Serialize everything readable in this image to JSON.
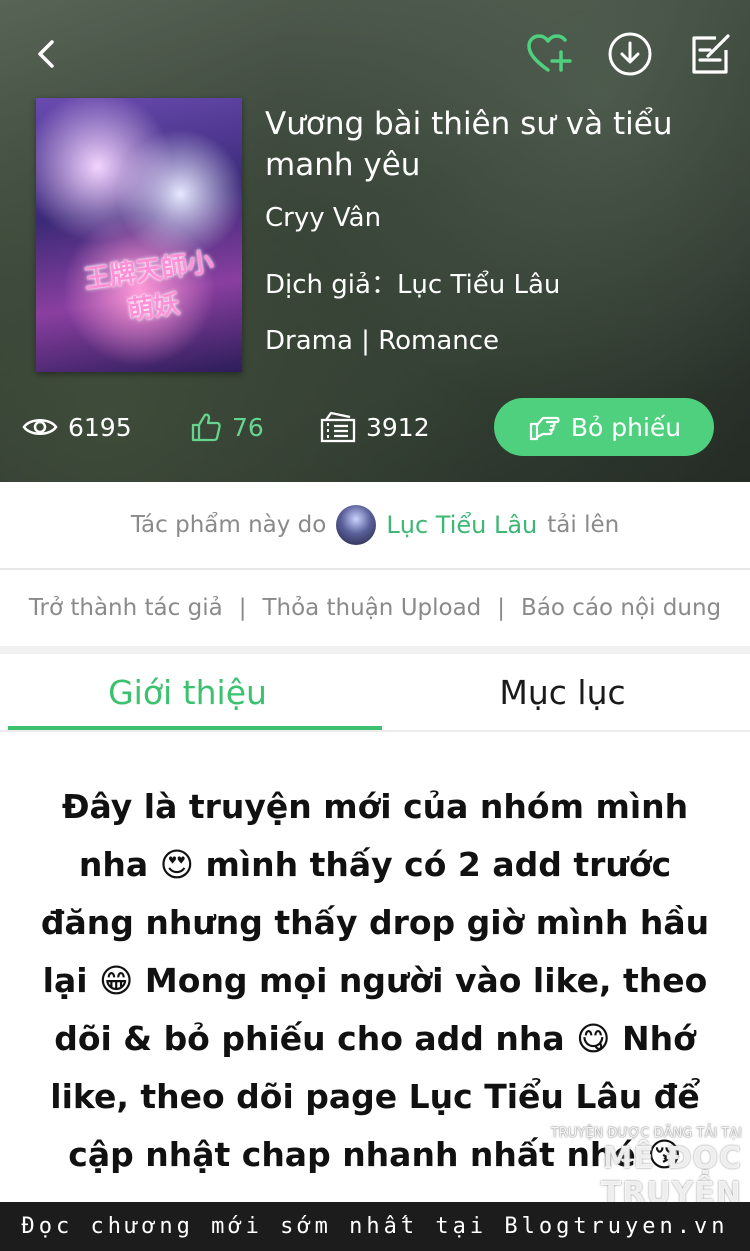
{
  "header": {
    "back_icon": "chevron-left-icon",
    "favorite_icon": "heart-plus-icon",
    "download_icon": "download-circle-icon",
    "edit_icon": "edit-note-icon",
    "accent": "#4fd07e"
  },
  "book": {
    "cover_text": "王牌天師小萌妖",
    "title": "Vương bài thiên sư và tiểu manh yêu",
    "author": "Cryy Vân",
    "translator": "Dịch giả：Lục Tiểu Lâu",
    "genres": "Drama | Romance"
  },
  "stats": {
    "views": "6195",
    "likes": "76",
    "tickets": "3912",
    "vote_label": "Bỏ phiếu"
  },
  "uploader": {
    "prefix": "Tác phẩm này do",
    "name": "Lục Tiểu Lâu",
    "suffix": "tải lên"
  },
  "links": [
    "Trở thành tác giả",
    "|",
    "Thỏa thuận Upload",
    "|",
    "Báo cáo nội dung"
  ],
  "tabs": [
    {
      "label": "Giới thiệu",
      "active": true
    },
    {
      "label": "Mục lục",
      "active": false
    }
  ],
  "intro_text": "Đây là truyện mới của nhóm mình nha 😍 mình thấy có 2 add trước đăng nhưng thấy drop giờ mình hầu lại 😁 Mong mọi người vào like, theo dõi & bỏ phiếu cho add nha 😋 Nhớ like, theo dõi page Lục Tiểu Lâu để cập nhật chap nhanh nhất nhé 😚",
  "watermark": {
    "small": "TRUYỆN ĐƯỢC ĐĂNG TẢI TẠI",
    "big": "MÊ ĐỌC TRUYỆN"
  },
  "footer": "Đọc chương mới sớm nhất tại Blogtruyen.vn"
}
